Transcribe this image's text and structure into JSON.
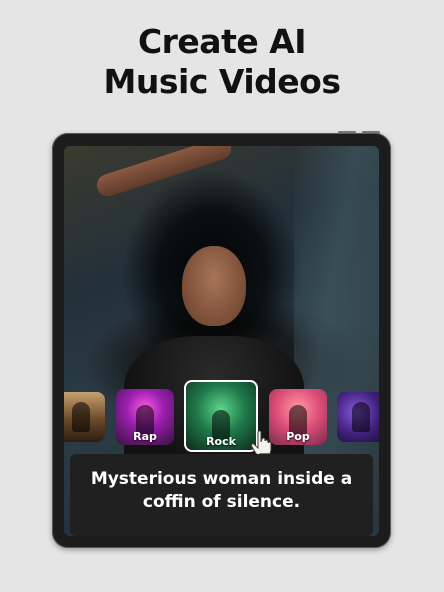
{
  "headline": {
    "line1": "Create AI",
    "line2": "Music Videos"
  },
  "genres": [
    {
      "label": "",
      "icon": "band-thumbnail"
    },
    {
      "label": "Rap",
      "icon": "rap-thumbnail"
    },
    {
      "label": "Rock",
      "icon": "rock-thumbnail",
      "selected": true
    },
    {
      "label": "Pop",
      "icon": "pop-thumbnail"
    },
    {
      "label": "",
      "icon": "concert-thumbnail"
    }
  ],
  "caption": {
    "line1": "Mysterious woman inside a",
    "line2": "coffin of silence."
  },
  "colors": {
    "background": "#e5e5e5",
    "tablet_frame": "#1c1c1c",
    "caption_card": "#202020",
    "selected_border": "#ffffff"
  }
}
